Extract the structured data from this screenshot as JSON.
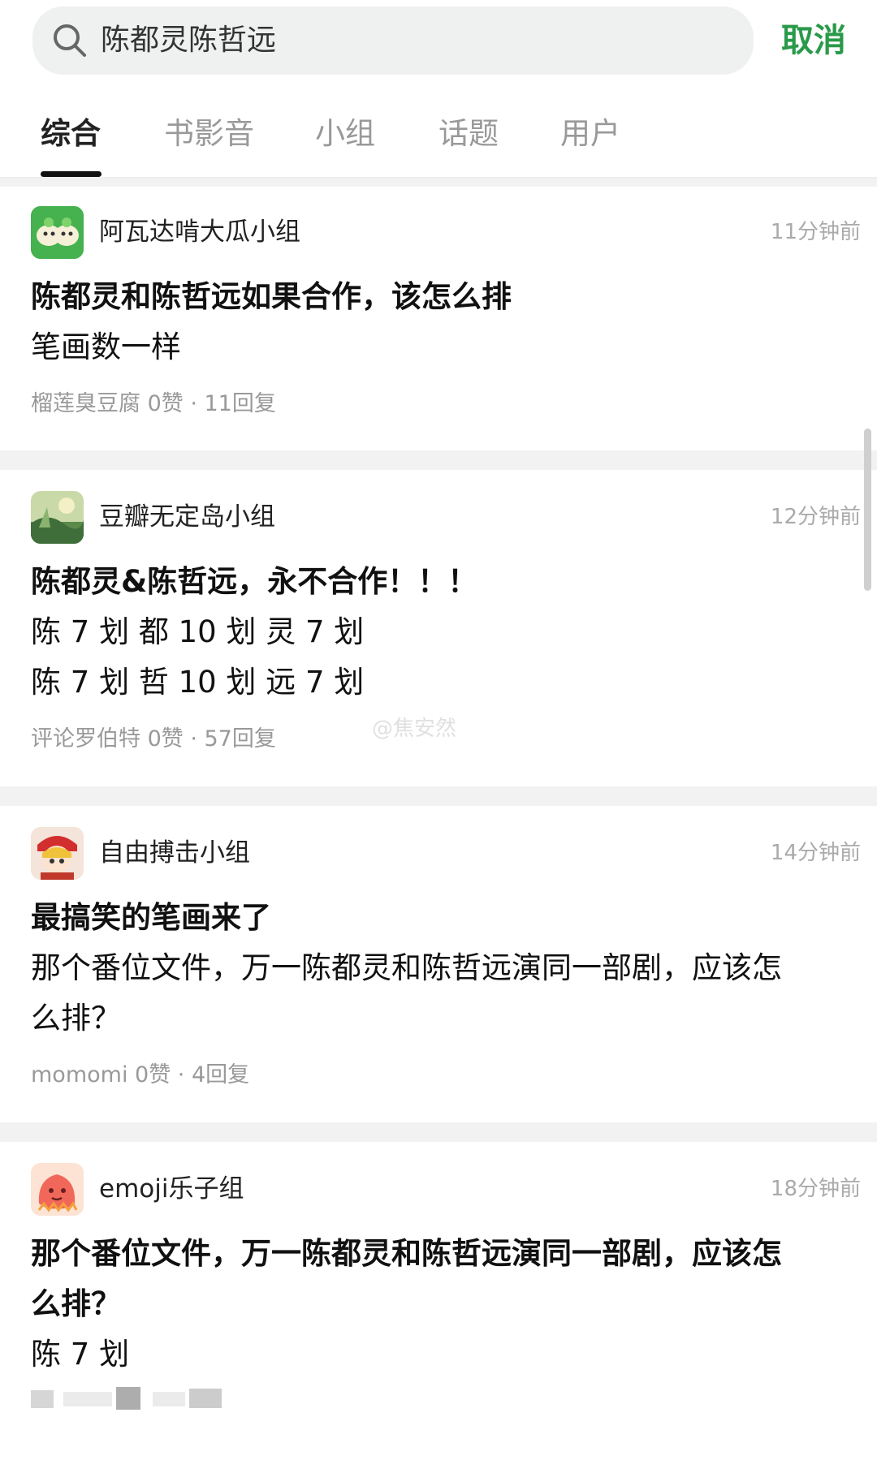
{
  "search": {
    "query": "陈都灵陈哲远",
    "cancel_label": "取消"
  },
  "tabs": [
    {
      "label": "综合",
      "active": true
    },
    {
      "label": "书影音",
      "active": false
    },
    {
      "label": "小组",
      "active": false
    },
    {
      "label": "话题",
      "active": false
    },
    {
      "label": "用户",
      "active": false
    }
  ],
  "posts": [
    {
      "group": "阿瓦达啃大瓜小组",
      "time": "11分钟前",
      "avatar_icon": "green-cartoon-group-avatar",
      "title": "陈都灵和陈哲远如果合作，该怎么排",
      "body": [
        "笔画数一样"
      ],
      "meta": "榴莲臭豆腐 0赞 · 11回复"
    },
    {
      "group": "豆瓣无定岛小组",
      "time": "12分钟前",
      "avatar_icon": "landscape-painting-avatar",
      "title": "陈都灵&陈哲远，永不合作！！！",
      "body": [
        "陈 7 划  都 10 划  灵 7 划",
        "陈 7 划  哲 10 划  远 7 划"
      ],
      "meta": "评论罗伯特 0赞 · 57回复"
    },
    {
      "group": "自由搏击小组",
      "time": "14分钟前",
      "avatar_icon": "anime-character-avatar",
      "title": "最搞笑的笔画来了",
      "body": [
        "那个番位文件，万一陈都灵和陈哲远演同一部剧，应该怎",
        "么排？"
      ],
      "meta": "momomi 0赞 · 4回复"
    },
    {
      "group": "emoji乐子组",
      "time": "18分钟前",
      "avatar_icon": "red-monster-avatar",
      "title": "那个番位文件，万一陈都灵和陈哲远演同一部剧，应该怎",
      "body": [
        "么排？",
        "陈 7 划"
      ],
      "meta": ""
    }
  ],
  "watermark": "@焦安然",
  "colors": {
    "accent_green": "#2a9a4a",
    "separator": "#f2f2f2",
    "muted_text": "#999999"
  }
}
